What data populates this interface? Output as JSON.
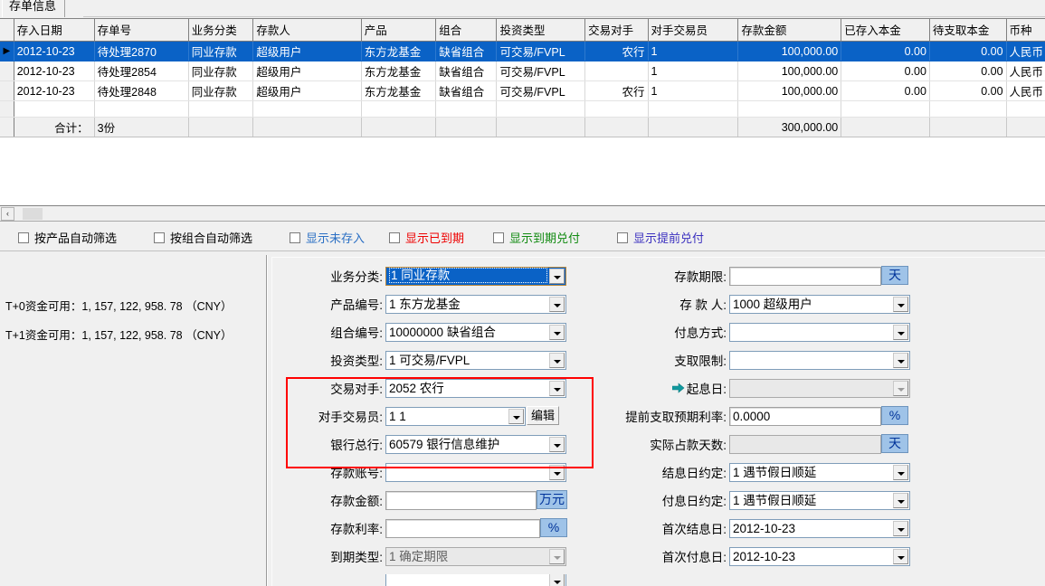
{
  "window": {
    "tab_label": "存单信息"
  },
  "grid": {
    "columns": [
      "存入日期",
      "存单号",
      "业务分类",
      "存款人",
      "产品",
      "组合",
      "投资类型",
      "交易对手",
      "对手交易员",
      "存款金额",
      "已存入本金",
      "待支取本金",
      "币种"
    ],
    "rows": [
      {
        "marker": "▶",
        "selected": true,
        "cells": [
          "2012-10-23",
          "待处理2870",
          "同业存款",
          "超级用户",
          "东方龙基金",
          "缺省组合",
          "可交易/FVPL",
          "农行",
          "1",
          "100,000.00",
          "0.00",
          "0.00",
          "人民币"
        ]
      },
      {
        "marker": "",
        "selected": false,
        "cells": [
          "2012-10-23",
          "待处理2854",
          "同业存款",
          "超级用户",
          "东方龙基金",
          "缺省组合",
          "可交易/FVPL",
          "",
          "1",
          "100,000.00",
          "0.00",
          "0.00",
          "人民币"
        ]
      },
      {
        "marker": "",
        "selected": false,
        "cells": [
          "2012-10-23",
          "待处理2848",
          "同业存款",
          "超级用户",
          "东方龙基金",
          "缺省组合",
          "可交易/FVPL",
          "农行",
          "1",
          "100,000.00",
          "0.00",
          "0.00",
          "人民币"
        ]
      }
    ],
    "totals": {
      "label": "合计：",
      "count": "3份",
      "amount": "300,000.00"
    }
  },
  "scrollbar": {
    "left_arrow": "‹"
  },
  "filters": [
    {
      "label": "按产品自动筛选",
      "color": "#000000",
      "checked": false
    },
    {
      "label": "按组合自动筛选",
      "color": "#000000",
      "checked": false
    },
    {
      "label": "显示未存入",
      "color": "#2a6fc4",
      "checked": false
    },
    {
      "label": "显示已到期",
      "color": "#ee0000",
      "checked": false
    },
    {
      "label": "显示到期兑付",
      "color": "#108a10",
      "checked": false
    },
    {
      "label": "显示提前兑付",
      "color": "#3a2fbf",
      "checked": false
    }
  ],
  "funds": [
    {
      "label": "T+0资金可用：1, 157, 122, 958. 78 （CNY）"
    },
    {
      "label": "T+1资金可用：1, 157, 122, 958. 78 （CNY）"
    }
  ],
  "form": {
    "left": [
      {
        "label": "业务分类:",
        "value": "1    同业存款",
        "type": "combo",
        "state": "selected"
      },
      {
        "label": "产品编号:",
        "value": "1    东方龙基金",
        "type": "combo",
        "state": "normal"
      },
      {
        "label": "组合编号:",
        "value": "10000000    缺省组合",
        "type": "combo",
        "state": "normal"
      },
      {
        "label": "投资类型:",
        "value": "1    可交易/FVPL",
        "type": "combo",
        "state": "normal"
      },
      {
        "label": "交易对手:",
        "value": "2052    农行",
        "type": "combo",
        "state": "normal"
      },
      {
        "label": "对手交易员:",
        "value": "1    1",
        "type": "combo-edit",
        "state": "normal",
        "button": "编辑"
      },
      {
        "label": "银行总行:",
        "value": "60579    银行信息维护",
        "type": "combo",
        "state": "normal"
      },
      {
        "label": "存款账号:",
        "value": "",
        "type": "combo",
        "state": "normal"
      },
      {
        "label": "存款金额:",
        "value": "",
        "type": "text-unit",
        "unit": "万元"
      },
      {
        "label": "存款利率:",
        "value": "",
        "type": "text-unit",
        "unit": "%"
      },
      {
        "label": "到期类型:",
        "value": "1    确定期限",
        "type": "combo",
        "state": "disabled"
      }
    ],
    "right": [
      {
        "label": "存款期限:",
        "value": "",
        "type": "text-unit",
        "unit": "天"
      },
      {
        "label": "存 款 人:",
        "value": "1000    超级用户",
        "type": "combo",
        "state": "normal"
      },
      {
        "label": "付息方式:",
        "value": "",
        "type": "combo",
        "state": "normal"
      },
      {
        "label": "支取限制:",
        "value": "",
        "type": "combo",
        "state": "normal"
      },
      {
        "label": "起息日:",
        "value": "",
        "type": "combo",
        "state": "disabled",
        "icon": "green-arrow-icon"
      },
      {
        "label": "提前支取预期利率:",
        "value": "0.0000",
        "type": "text-unit",
        "unit": "%"
      },
      {
        "label": "实际占款天数:",
        "value": "",
        "type": "text-unit",
        "unit": "天",
        "disabled": true
      },
      {
        "label": "结息日约定:",
        "value": "1    遇节假日顺延",
        "type": "combo",
        "state": "normal"
      },
      {
        "label": "付息日约定:",
        "value": "1    遇节假日顺延",
        "type": "combo",
        "state": "normal"
      },
      {
        "label": "首次结息日:",
        "value": "2012-10-23",
        "type": "combo",
        "state": "normal"
      },
      {
        "label": "首次付息日:",
        "value": "2012-10-23",
        "type": "combo",
        "state": "normal"
      }
    ]
  },
  "highlight": {
    "color": "#ff0000"
  },
  "colors": {
    "selection": "#0a62c6",
    "unit_button": "#9fc3e8",
    "panel": "#f0f0f0"
  }
}
